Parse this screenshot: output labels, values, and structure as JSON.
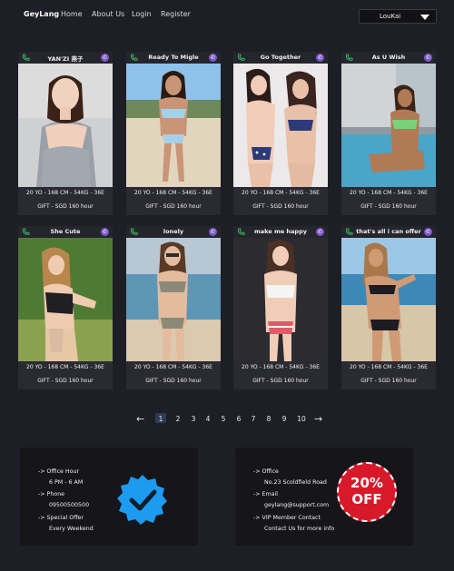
{
  "nav": {
    "brand": "GeyLang",
    "links": [
      "Home",
      "About Us",
      "Login",
      "Register"
    ],
    "select_value": "LouKai"
  },
  "cards": [
    {
      "name": "YAN'ZI 燕子",
      "stats": "20 YO - 168 CM - 54KG - 36E",
      "gift": "GIFT - SGD 160 hour"
    },
    {
      "name": "Ready To Migle",
      "stats": "20 YO - 168 CM - 54KG - 36E",
      "gift": "GIFT - SGD 160 hour"
    },
    {
      "name": "Go Together",
      "stats": "20 YO - 168 CM - 54KG - 36E",
      "gift": "GIFT - SGD 160 hour"
    },
    {
      "name": "As U Wish",
      "stats": "20 YO - 168 CM - 54KG - 36E",
      "gift": "GIFT - SGD 160 hour"
    },
    {
      "name": "She Cute",
      "stats": "20 YO - 168 CM - 54KG - 36E",
      "gift": "GIFT - SGD 160 hour"
    },
    {
      "name": "lonely",
      "stats": "20 YO - 168 CM - 54KG - 36E",
      "gift": "GIFT - SGD 160 hour"
    },
    {
      "name": "make me happy",
      "stats": "20 YO - 168 CM - 54KG - 36E",
      "gift": "GIFT - SGD 160 hour"
    },
    {
      "name": "that's all i can offer",
      "stats": "20 YO - 168 CM - 54KG - 36E",
      "gift": "GIFT - SGD 160 hour"
    }
  ],
  "pagination": {
    "prev": "←",
    "next": "→",
    "pages": [
      "1",
      "2",
      "3",
      "4",
      "5",
      "6",
      "7",
      "8",
      "9",
      "10"
    ],
    "current": "1"
  },
  "footer": {
    "left": {
      "office_hour_label": "-> Office Hour",
      "office_hour_value": "6 PM - 6 AM",
      "phone_label": "-> Phone",
      "phone_value": "09500500500",
      "special_label": "-> Special Offer",
      "special_value": "Every  Weekend"
    },
    "right": {
      "office_label": "-> Office",
      "office_value": "No.23 Scoldfield Road",
      "email_label": "-> Email",
      "email_value": "geylang@support.com",
      "vip_label": "-> VIP Member Contact",
      "vip_value": "Contact Us for more info"
    },
    "badge_text_top": "20%",
    "badge_text_bottom": "OFF"
  },
  "colors": {
    "background": "#1e1e26",
    "card": "#2a2a33",
    "footer_box": "#15151a",
    "verified_blue": "#1d9bf0",
    "badge_red": "#d7192a",
    "viber_purple": "#7b57c8",
    "phone_green": "#3cc35c"
  },
  "icons": {
    "card_left": "phone-icon",
    "card_right": "viber-icon",
    "footer_left": "verified-check-icon",
    "footer_right": "discount-badge-icon",
    "nav_select": "caret-down-icon"
  }
}
